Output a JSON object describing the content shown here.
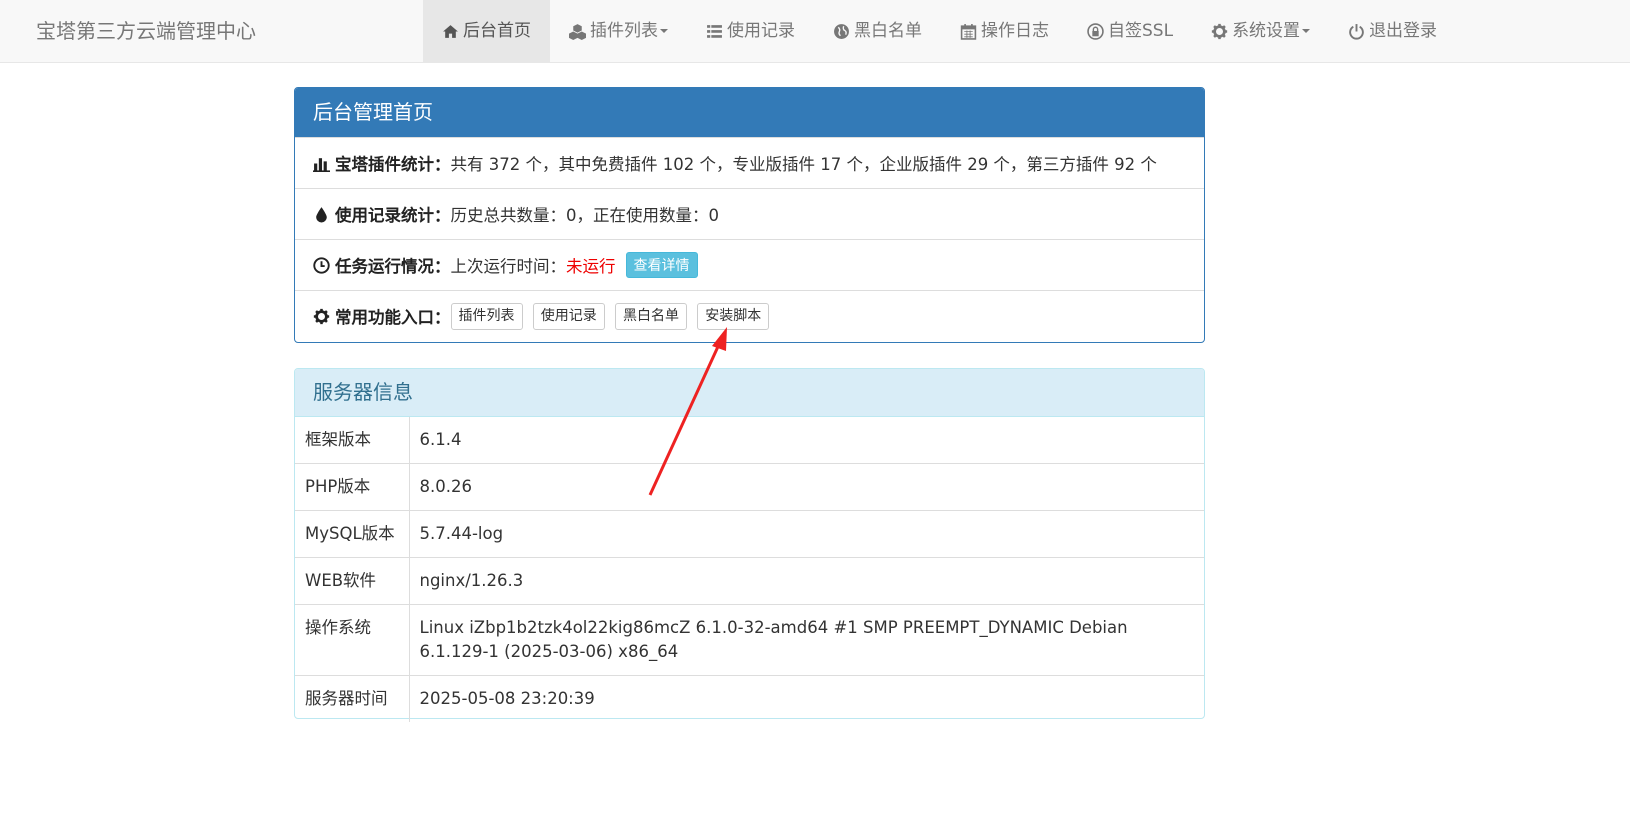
{
  "navbar": {
    "brand": "宝塔第三方云端管理中心",
    "items": [
      {
        "label": "后台首页",
        "icon": "home-icon"
      },
      {
        "label": "插件列表",
        "icon": "cubes-icon"
      },
      {
        "label": "使用记录",
        "icon": "list-icon"
      },
      {
        "label": "黑白名单",
        "icon": "globe-icon"
      },
      {
        "label": "操作日志",
        "icon": "calendar-icon"
      },
      {
        "label": "自签SSL",
        "icon": "lock-icon"
      },
      {
        "label": "系统设置",
        "icon": "gear-icon"
      },
      {
        "label": "退出登录",
        "icon": "power-icon"
      }
    ]
  },
  "dashboard": {
    "title": "后台管理首页",
    "plugin_stats": {
      "label": "宝塔插件统计：",
      "text": "共有 372 个，其中免费插件 102 个，专业版插件 17 个，企业版插件 29 个，第三方插件 92 个"
    },
    "usage_stats": {
      "label": "使用记录统计：",
      "text": "历史总共数量：0，正在使用数量：0"
    },
    "task_status": {
      "label": "任务运行情况：",
      "text": "上次运行时间：",
      "status": "未运行",
      "detail_button": "查看详情"
    },
    "shortcuts": {
      "label": "常用功能入口：",
      "buttons": [
        "插件列表",
        "使用记录",
        "黑白名单",
        "安装脚本"
      ]
    }
  },
  "server_info": {
    "title": "服务器信息",
    "rows": [
      {
        "key": "框架版本",
        "value": "6.1.4"
      },
      {
        "key": "PHP版本",
        "value": "8.0.26"
      },
      {
        "key": "MySQL版本",
        "value": "5.7.44-log"
      },
      {
        "key": "WEB软件",
        "value": "nginx/1.26.3"
      },
      {
        "key": "操作系统",
        "value": "Linux iZbp1b2tzk4ol22kig86mcZ 6.1.0-32-amd64 #1 SMP PREEMPT_DYNAMIC Debian 6.1.129-1 (2025-03-06) x86_64"
      },
      {
        "key": "服务器时间",
        "value": "2025-05-08 23:20:39"
      }
    ]
  },
  "colors": {
    "primary": "#337ab7",
    "info_heading_bg": "#d9edf7",
    "info_button": "#5bc0de",
    "status_red": "#ee0000",
    "annotation_arrow": "#ee2222"
  }
}
